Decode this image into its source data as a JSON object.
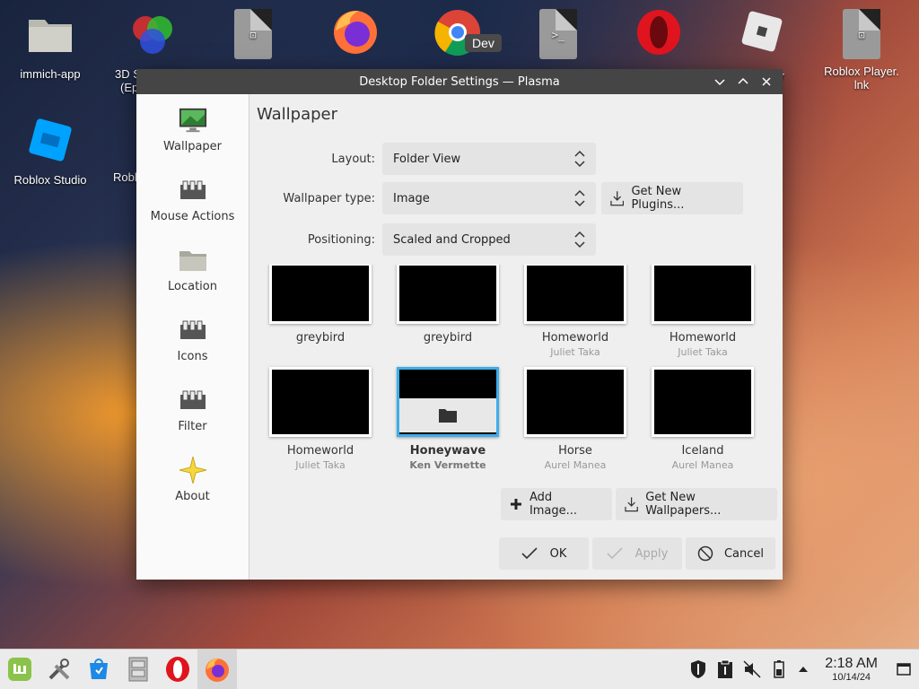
{
  "desktop": {
    "icons": [
      {
        "label": "immich-app"
      },
      {
        "label": "3D S"
      },
      {
        "label": "(Ep"
      },
      {
        "label": "Roblox Studio"
      },
      {
        "label": "Robl"
      },
      {
        "label": "yer"
      },
      {
        "label": "Roblox Player."
      },
      {
        "label": "lnk"
      }
    ],
    "chrome_badge": "Dev"
  },
  "dialog": {
    "title": "Desktop Folder Settings — Plasma",
    "sidebar": [
      {
        "label": "Wallpaper"
      },
      {
        "label": "Mouse Actions"
      },
      {
        "label": "Location"
      },
      {
        "label": "Icons"
      },
      {
        "label": "Filter"
      },
      {
        "label": "About"
      }
    ],
    "page_title": "Wallpaper",
    "layout": {
      "label": "Layout:",
      "value": "Folder View"
    },
    "wallpaper_type": {
      "label": "Wallpaper type:",
      "value": "Image"
    },
    "get_new_plugins": "Get New Plugins...",
    "positioning": {
      "label": "Positioning:",
      "value": "Scaled and Cropped"
    },
    "wallpapers": [
      {
        "name": "greybird",
        "author": ""
      },
      {
        "name": "greybird",
        "author": ""
      },
      {
        "name": "Homeworld",
        "author": "Juliet Taka"
      },
      {
        "name": "Homeworld",
        "author": "Juliet Taka"
      },
      {
        "name": "Homeworld",
        "author": "Juliet Taka"
      },
      {
        "name": "Honeywave",
        "author": "Ken Vermette"
      },
      {
        "name": "Horse",
        "author": "Aurel Manea"
      },
      {
        "name": "Iceland",
        "author": "Aurel Manea"
      }
    ],
    "add_image": "Add Image...",
    "get_new_wallpapers": "Get New Wallpapers...",
    "ok": "OK",
    "apply": "Apply",
    "cancel": "Cancel"
  },
  "taskbar": {
    "time": "2:18 AM",
    "date": "10/14/24"
  }
}
